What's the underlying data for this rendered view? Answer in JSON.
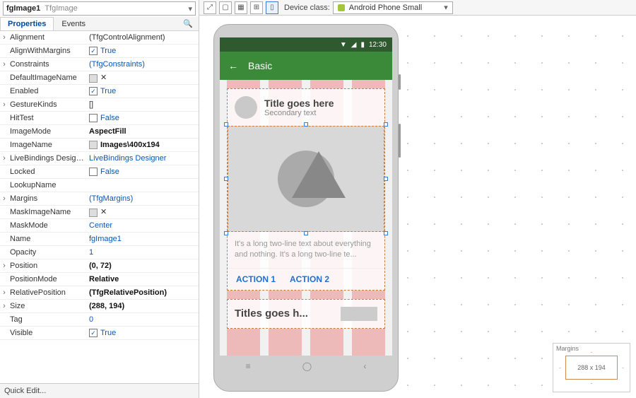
{
  "inspector": {
    "object_name": "fgImage1",
    "object_type": "TfgImage",
    "tabs": {
      "properties": "Properties",
      "events": "Events"
    },
    "search_glyph": "🔍",
    "rows": [
      {
        "exp": "›",
        "name": "Alignment",
        "value": "(TfgControlAlignment)",
        "style": "plain"
      },
      {
        "exp": "",
        "name": "AlignWithMargins",
        "value": "True",
        "style": "cb_on"
      },
      {
        "exp": "›",
        "name": "Constraints",
        "value": "(TfgConstraints)",
        "style": "link"
      },
      {
        "exp": "",
        "name": "DefaultImageName",
        "value": "✕",
        "style": "swatch"
      },
      {
        "exp": "",
        "name": "Enabled",
        "value": "True",
        "style": "cb_on"
      },
      {
        "exp": "›",
        "name": "GestureKinds",
        "value": "[]",
        "style": "plain"
      },
      {
        "exp": "",
        "name": "HitTest",
        "value": "False",
        "style": "cb_off"
      },
      {
        "exp": "",
        "name": "ImageMode",
        "value": "AspectFill",
        "style": "bold"
      },
      {
        "exp": "",
        "name": "ImageName",
        "value": "Images\\400x194",
        "style": "bold_swatch"
      },
      {
        "exp": "›",
        "name": "LiveBindings Designer",
        "value": "LiveBindings Designer",
        "style": "link"
      },
      {
        "exp": "",
        "name": "Locked",
        "value": "False",
        "style": "cb_off"
      },
      {
        "exp": "",
        "name": "LookupName",
        "value": "",
        "style": "plain"
      },
      {
        "exp": "›",
        "name": "Margins",
        "value": "(TfgMargins)",
        "style": "link"
      },
      {
        "exp": "",
        "name": "MaskImageName",
        "value": "✕",
        "style": "swatch"
      },
      {
        "exp": "",
        "name": "MaskMode",
        "value": "Center",
        "style": "link"
      },
      {
        "exp": "",
        "name": "Name",
        "value": "fgImage1",
        "style": "link"
      },
      {
        "exp": "",
        "name": "Opacity",
        "value": "1",
        "style": "link"
      },
      {
        "exp": "›",
        "name": "Position",
        "value": "(0, 72)",
        "style": "bold"
      },
      {
        "exp": "",
        "name": "PositionMode",
        "value": "Relative",
        "style": "bold"
      },
      {
        "exp": "›",
        "name": "RelativePosition",
        "value": "(TfgRelativePosition)",
        "style": "bold"
      },
      {
        "exp": "›",
        "name": "Size",
        "value": "(288, 194)",
        "style": "bold"
      },
      {
        "exp": "",
        "name": "Tag",
        "value": "0",
        "style": "link"
      },
      {
        "exp": "",
        "name": "Visible",
        "value": "True",
        "style": "cb_on"
      }
    ],
    "quick_edit": "Quick Edit..."
  },
  "toolbar": {
    "device_label": "Device class:",
    "device_value": "Android Phone Small"
  },
  "device": {
    "status_time": "12:30",
    "appbar_title": "Basic",
    "card": {
      "title": "Title goes here",
      "subtitle": "Secondary text",
      "body": "It's a long two-line text about everything and nothing. It's a long two-line te...",
      "action1": "ACTION 1",
      "action2": "ACTION 2"
    },
    "card2_title": "Titles goes h..."
  },
  "margins_panel": {
    "label": "Margins",
    "size": "288 x 194"
  }
}
